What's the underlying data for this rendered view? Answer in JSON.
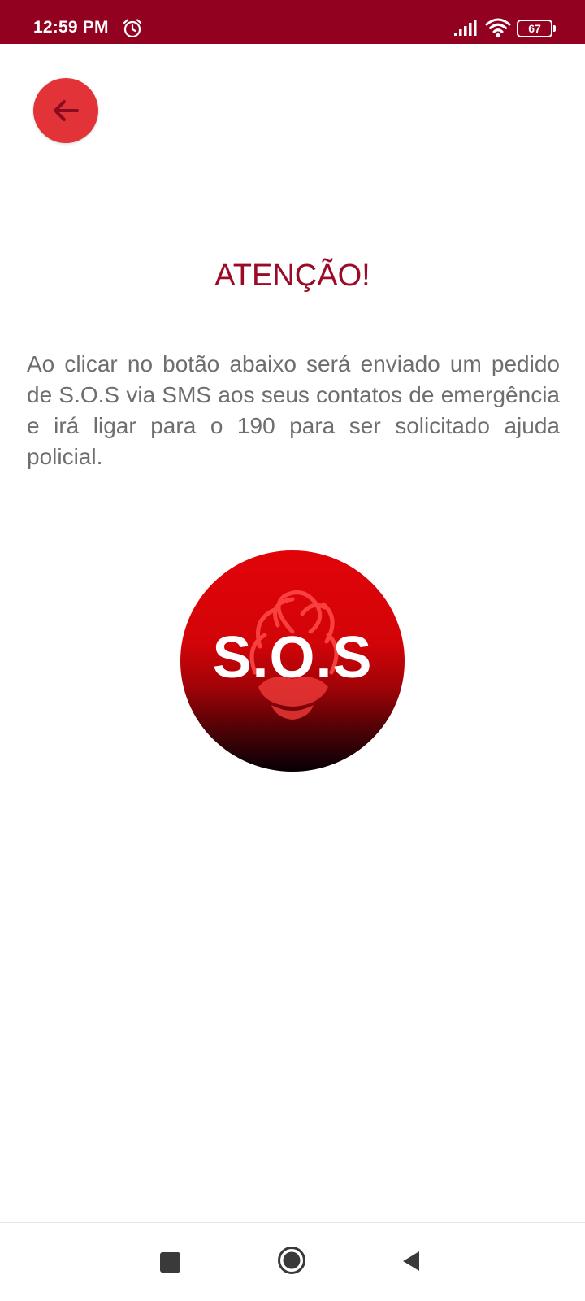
{
  "status_bar": {
    "time": "12:59 PM",
    "battery_level": "67",
    "colors": {
      "background": "#930120"
    },
    "icons": [
      "alarm-icon",
      "signal-icon",
      "wifi-icon",
      "battery-icon"
    ]
  },
  "toolbar": {
    "back_icon": "arrow-left-icon",
    "back_color": "#e23338"
  },
  "main": {
    "title": "ATENÇÃO!",
    "title_color": "#9b0a26",
    "message": "Ao clicar no botão abaixo será enviado um pedido de S.O.S via SMS aos seus contatos de emergência e irá ligar para o 190 para ser solicitado ajuda policial.",
    "sos_button": {
      "label": "S.O.S",
      "icon": "rose-icon",
      "colors": [
        "#e10409",
        "#050006"
      ]
    }
  },
  "nav_bar": {
    "icons": [
      "recent-apps-icon",
      "home-icon",
      "back-triangle-icon"
    ]
  }
}
